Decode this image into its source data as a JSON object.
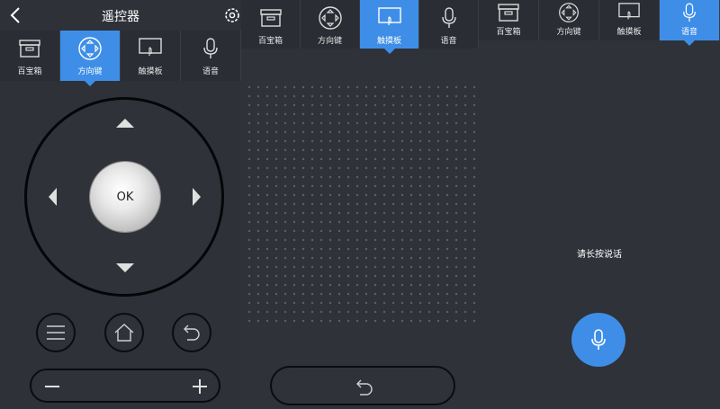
{
  "header": {
    "title": "遥控器"
  },
  "tabs_panel1": [
    {
      "label": "百宝箱",
      "icon": "toolbox-icon"
    },
    {
      "label": "方向键",
      "icon": "direction-pad-icon"
    },
    {
      "label": "触摸板",
      "icon": "touchpad-icon"
    },
    {
      "label": "语音",
      "icon": "microphone-icon"
    }
  ],
  "tabs_panel2": [
    {
      "label": "百宝箱",
      "icon": "toolbox-icon"
    },
    {
      "label": "方向键",
      "icon": "direction-pad-icon"
    },
    {
      "label": "触摸板",
      "icon": "touchpad-icon"
    },
    {
      "label": "语音",
      "icon": "microphone-icon"
    }
  ],
  "tabs_panel3": [
    {
      "label": "百宝箱",
      "icon": "toolbox-icon"
    },
    {
      "label": "方向键",
      "icon": "direction-pad-icon"
    },
    {
      "label": "触摸板",
      "icon": "touchpad-icon"
    },
    {
      "label": "语音",
      "icon": "microphone-icon"
    }
  ],
  "active_tabs": {
    "panel1": "方向键",
    "panel2": "触摸板",
    "panel3": "语音"
  },
  "dpad": {
    "ok_label": "OK"
  },
  "voice": {
    "hint": "请长按说话"
  },
  "colors": {
    "accent": "#3e8ee8",
    "background": "#2f3239"
  }
}
